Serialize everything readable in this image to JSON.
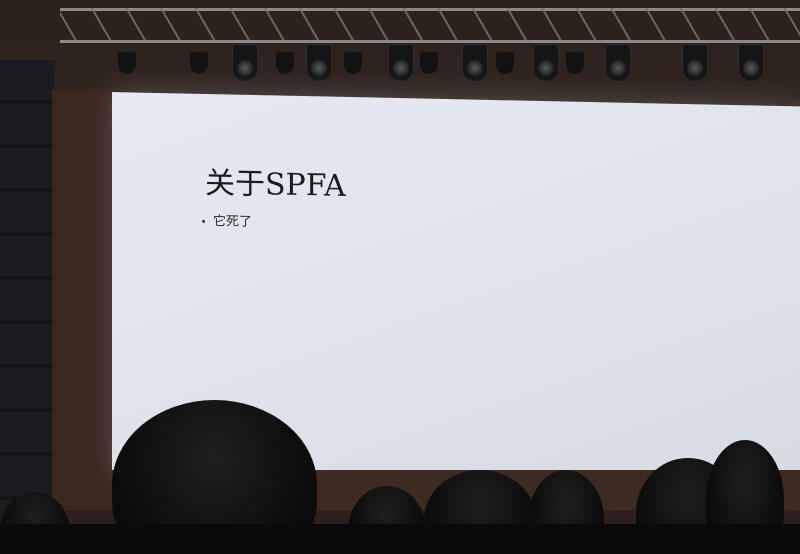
{
  "slide": {
    "title": "关于SPFA",
    "bullet": "它死了"
  },
  "colors": {
    "screen": "#e2e6ec",
    "stage": "#3a271e",
    "text": "#1b1b1b"
  }
}
